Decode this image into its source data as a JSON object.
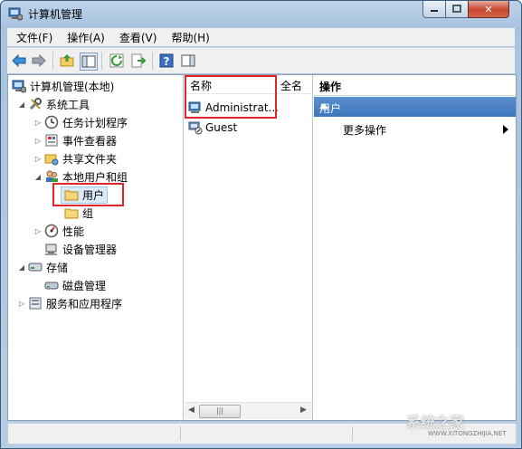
{
  "window": {
    "title": "计算机管理"
  },
  "menu": [
    "文件(F)",
    "操作(A)",
    "查看(V)",
    "帮助(H)"
  ],
  "toolbar_icons": [
    "back-icon",
    "forward-icon",
    "up-folder-icon",
    "show-hide-tree-icon",
    "refresh-icon",
    "export-list-icon",
    "help-icon",
    "action-pane-icon"
  ],
  "tree": {
    "root": "计算机管理(本地)",
    "system_tools": "系统工具",
    "task_scheduler": "任务计划程序",
    "event_viewer": "事件查看器",
    "shared_folders": "共享文件夹",
    "local_users_groups": "本地用户和组",
    "users": "用户",
    "groups": "组",
    "performance": "性能",
    "device_manager": "设备管理器",
    "storage": "存储",
    "disk_management": "磁盘管理",
    "services_apps": "服务和应用程序"
  },
  "list": {
    "col_name": "名称",
    "col_fullname": "全名",
    "rows": [
      "Administrat...",
      "Guest"
    ]
  },
  "actions": {
    "header": "操作",
    "section": "用户",
    "more": "更多操作"
  },
  "colors": {
    "highlight_box": "#e0262b",
    "action_section": "#3f75bb"
  },
  "watermark": {
    "brand": "系统之家",
    "url": "WWW.XITONGZHIJIA.NET"
  }
}
